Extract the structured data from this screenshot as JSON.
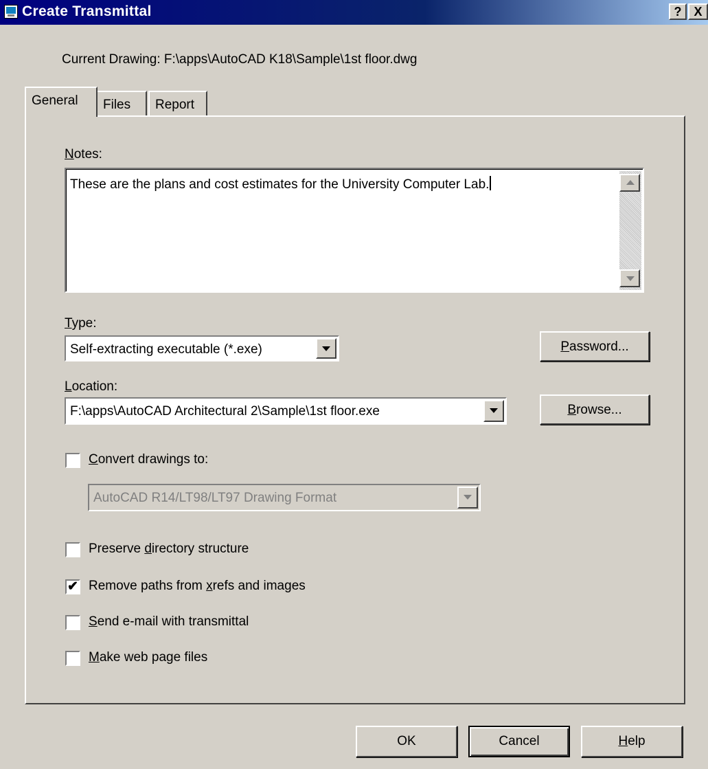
{
  "window": {
    "title": "Create Transmittal",
    "help_glyph": "?",
    "close_glyph": "X"
  },
  "current_drawing": "Current Drawing: F:\\apps\\AutoCAD K18\\Sample\\1st floor.dwg",
  "tabs": [
    {
      "label": "General",
      "active": true
    },
    {
      "label": "Files",
      "active": false
    },
    {
      "label": "Report",
      "active": false
    }
  ],
  "notes": {
    "label_key": "N",
    "label_rest": "otes:",
    "value": "These are the plans and cost estimates for the University Computer Lab."
  },
  "type": {
    "label_key": "T",
    "label_rest": "ype:",
    "value": "Self-extracting executable (*.exe)"
  },
  "password_button": {
    "key": "P",
    "rest": "assword..."
  },
  "location": {
    "label_key": "L",
    "label_rest": "ocation:",
    "value": "F:\\apps\\AutoCAD Architectural 2\\Sample\\1st floor.exe"
  },
  "browse_button": {
    "key": "B",
    "rest": "rowse..."
  },
  "convert": {
    "checked": false,
    "label_key": "C",
    "label_rest": "onvert drawings to:",
    "format_value": "AutoCAD R14/LT98/LT97 Drawing Format"
  },
  "options": [
    {
      "checked": false,
      "label_pre": "Preserve ",
      "label_key": "d",
      "label_post": "irectory structure"
    },
    {
      "checked": true,
      "label_pre": "Remove paths from ",
      "label_key": "x",
      "label_post": "refs and images"
    },
    {
      "checked": false,
      "label_pre": "",
      "label_key": "S",
      "label_post": "end e-mail with transmittal"
    },
    {
      "checked": false,
      "label_pre": "",
      "label_key": "M",
      "label_post": "ake web page files"
    }
  ],
  "footer": {
    "ok": "OK",
    "cancel": "Cancel",
    "help_key": "H",
    "help_rest": "elp"
  },
  "check_glyph": "✔"
}
